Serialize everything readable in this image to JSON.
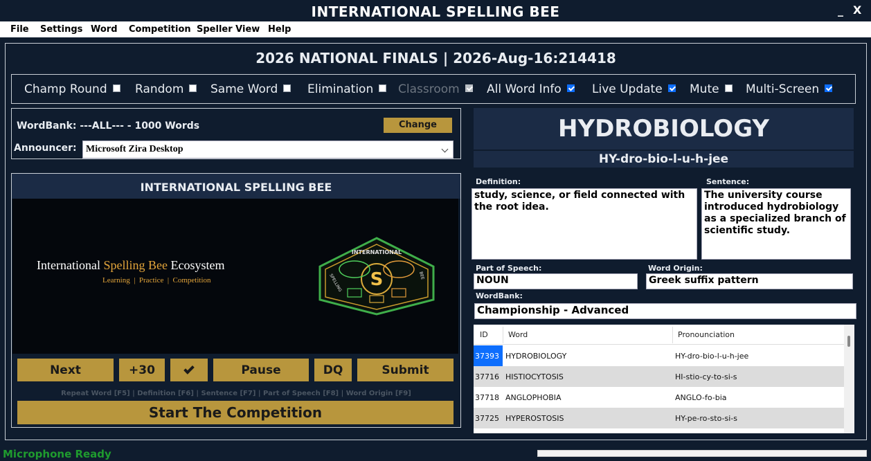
{
  "window": {
    "title": "INTERNATIONAL SPELLING BEE",
    "minimize": "_",
    "close": "X"
  },
  "menu": [
    "File",
    "Settings",
    "Word",
    "Competition",
    "Speller View",
    "Help"
  ],
  "headline": "2026 NATIONAL FINALS | 2026-Aug-16:214418",
  "options": [
    {
      "label": "Champ Round",
      "checked": false,
      "enabled": true
    },
    {
      "label": "Random",
      "checked": false,
      "enabled": true
    },
    {
      "label": "Same Word",
      "checked": false,
      "enabled": true
    },
    {
      "label": "Elimination",
      "checked": false,
      "enabled": true
    },
    {
      "label": "Classroom",
      "checked": true,
      "enabled": false
    },
    {
      "label": "All Word Info",
      "checked": true,
      "enabled": true
    },
    {
      "label": "Live Update",
      "checked": true,
      "enabled": true
    },
    {
      "label": "Mute",
      "checked": false,
      "enabled": true
    },
    {
      "label": "Multi-Screen",
      "checked": true,
      "enabled": true
    }
  ],
  "wordbank_panel": {
    "wordbank_text": "WordBank: ---ALL--- - 1000 Words",
    "change_label": "Change",
    "announcer_label": "Announcer:",
    "announcer_value": "Microsoft Zira Desktop"
  },
  "video": {
    "title": "INTERNATIONAL SPELLING BEE",
    "brand_main": "International ",
    "brand_accent": "Spelling Bee",
    "brand_tail": " Ecosystem",
    "tagline": "Learning  |  Practice  |  Competition",
    "logo_top": "INTERNATIONAL",
    "logo_left": "SPELLING",
    "logo_right": "BEE",
    "logo_letter": "S"
  },
  "controls": {
    "next": "Next",
    "plus30": "+30",
    "pause": "Pause",
    "dq": "DQ",
    "submit": "Submit",
    "hint": "Repeat Word [F5] | Definition [F6] | Sentence [F7] | Part of Speech [F8] | Word Origin [F9]",
    "start": "Start The Competition"
  },
  "word": {
    "text": "HYDROBIOLOGY",
    "pronunciation": "HY-dro-bio-l-u-h-jee",
    "definition_label": "Definition:",
    "definition": "study, science, or field connected with the root idea.",
    "sentence_label": "Sentence:",
    "sentence": "The university course introduced hydrobiology as a specialized branch of scientific study.",
    "pos_label": "Part of Speech:",
    "pos": "NOUN",
    "origin_label": "Word Origin:",
    "origin": "Greek suffix pattern",
    "wordbank_label": "WordBank:",
    "wordbank": "Championship - Advanced"
  },
  "grid": {
    "columns": [
      "ID",
      "Word",
      "Pronounciation"
    ],
    "rows": [
      {
        "id": "37393",
        "word": "HYDROBIOLOGY",
        "pron": "HY-dro-bio-l-u-h-jee"
      },
      {
        "id": "37716",
        "word": "HISTIOCYTOSIS",
        "pron": "HI-stio-cy-to-si-s"
      },
      {
        "id": "37718",
        "word": "ANGLOPHOBIA",
        "pron": "ANGLO-fo-bia"
      },
      {
        "id": "37725",
        "word": "HYPEROSTOSIS",
        "pron": "HY-pe-ro-sto-si-s"
      }
    ]
  },
  "status": "Microphone Ready",
  "colors": {
    "background": "#0f1c2e",
    "gold": "#b8963d",
    "panel": "#1b2b45",
    "select_blue": "#0d6efd",
    "status_green": "#1f9b2e"
  }
}
